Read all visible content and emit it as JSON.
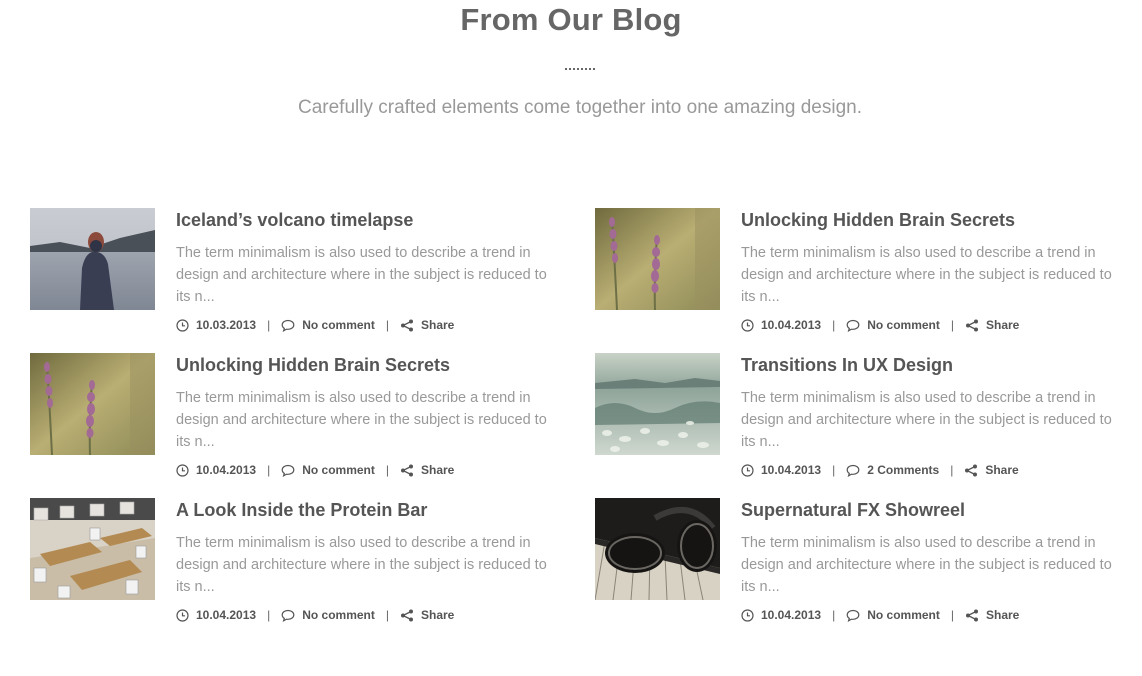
{
  "header": {
    "title": "From Our Blog",
    "subtitle": "Carefully crafted elements come together into one amazing design."
  },
  "posts": [
    {
      "title": "Iceland’s volcano timelapse",
      "excerpt": "The term minimalism is also used to describe a trend in design and architecture where in the subject is reduced to its n...",
      "date": "10.03.2013",
      "comments": "No comment",
      "share": "Share",
      "image": "woman-by-lake"
    },
    {
      "title": "Unlocking Hidden Brain Secrets",
      "excerpt": "The term minimalism is also used to describe a trend in design and architecture where in the subject is reduced to its n...",
      "date": "10.04.2013",
      "comments": "No comment",
      "share": "Share",
      "image": "lavender-flowers"
    },
    {
      "title": "Unlocking Hidden Brain Secrets",
      "excerpt": "The term minimalism is also used to describe a trend in design and architecture where in the subject is reduced to its n...",
      "date": "10.04.2013",
      "comments": "No comment",
      "share": "Share",
      "image": "lavender-flowers"
    },
    {
      "title": "Transitions In UX Design",
      "excerpt": "The term minimalism is also used to describe a trend in design and architecture where in the subject is reduced to its n...",
      "date": "10.04.2013",
      "comments": "2 Comments",
      "share": "Share",
      "image": "water-waves"
    },
    {
      "title": "A Look Inside the Protein Bar",
      "excerpt": "The term minimalism is also used to describe a trend in design and architecture where in the subject is reduced to its n...",
      "date": "10.04.2013",
      "comments": "No comment",
      "share": "Share",
      "image": "cafe-tables"
    },
    {
      "title": "Supernatural FX Showreel",
      "excerpt": "The term minimalism is also used to describe a trend in design and architecture where in the subject is reduced to its n...",
      "date": "10.04.2013",
      "comments": "No comment",
      "share": "Share",
      "image": "headphones-on-piano"
    }
  ],
  "icons": {
    "date": "clock-icon",
    "comments": "speech-bubble-icon",
    "share": "share-icon"
  },
  "colors": {
    "title": "#666666",
    "text_muted": "#999999",
    "meta_text": "#555555"
  }
}
